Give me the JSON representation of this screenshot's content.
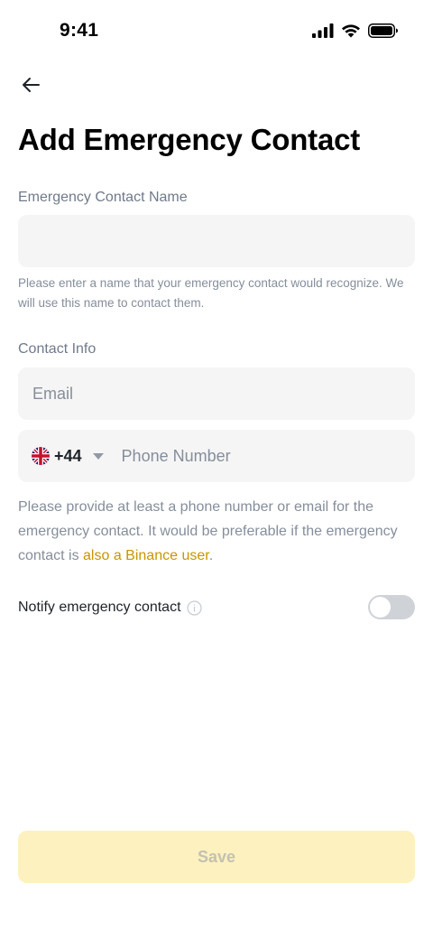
{
  "status_bar": {
    "time": "9:41",
    "icons": [
      "signal-icon",
      "wifi-icon",
      "battery-icon"
    ]
  },
  "header": {
    "back_icon": "arrow-left-icon",
    "title": "Add Emergency Contact"
  },
  "name_section": {
    "label": "Emergency Contact Name",
    "value": "",
    "placeholder": "",
    "hint": "Please enter a name that your emergency contact would recognize. We will use this name to contact them."
  },
  "contact_section": {
    "label": "Contact Info",
    "email_placeholder": "Email",
    "email_value": "",
    "country_flag": "uk-flag-icon",
    "country_code": "+44",
    "phone_placeholder": "Phone Number",
    "phone_value": "",
    "hint_prefix": "Please provide at least a phone number or email for the emergency contact. It would be preferable if the emergency contact is ",
    "hint_link": "also a Binance user",
    "hint_suffix": "."
  },
  "notify": {
    "label": "Notify emergency contact",
    "info_icon": "info-icon",
    "enabled": false
  },
  "footer": {
    "save_label": "Save"
  },
  "colors": {
    "accent": "#c99400",
    "button_disabled_bg": "#fdf1bf",
    "field_bg": "#f5f5f5"
  }
}
